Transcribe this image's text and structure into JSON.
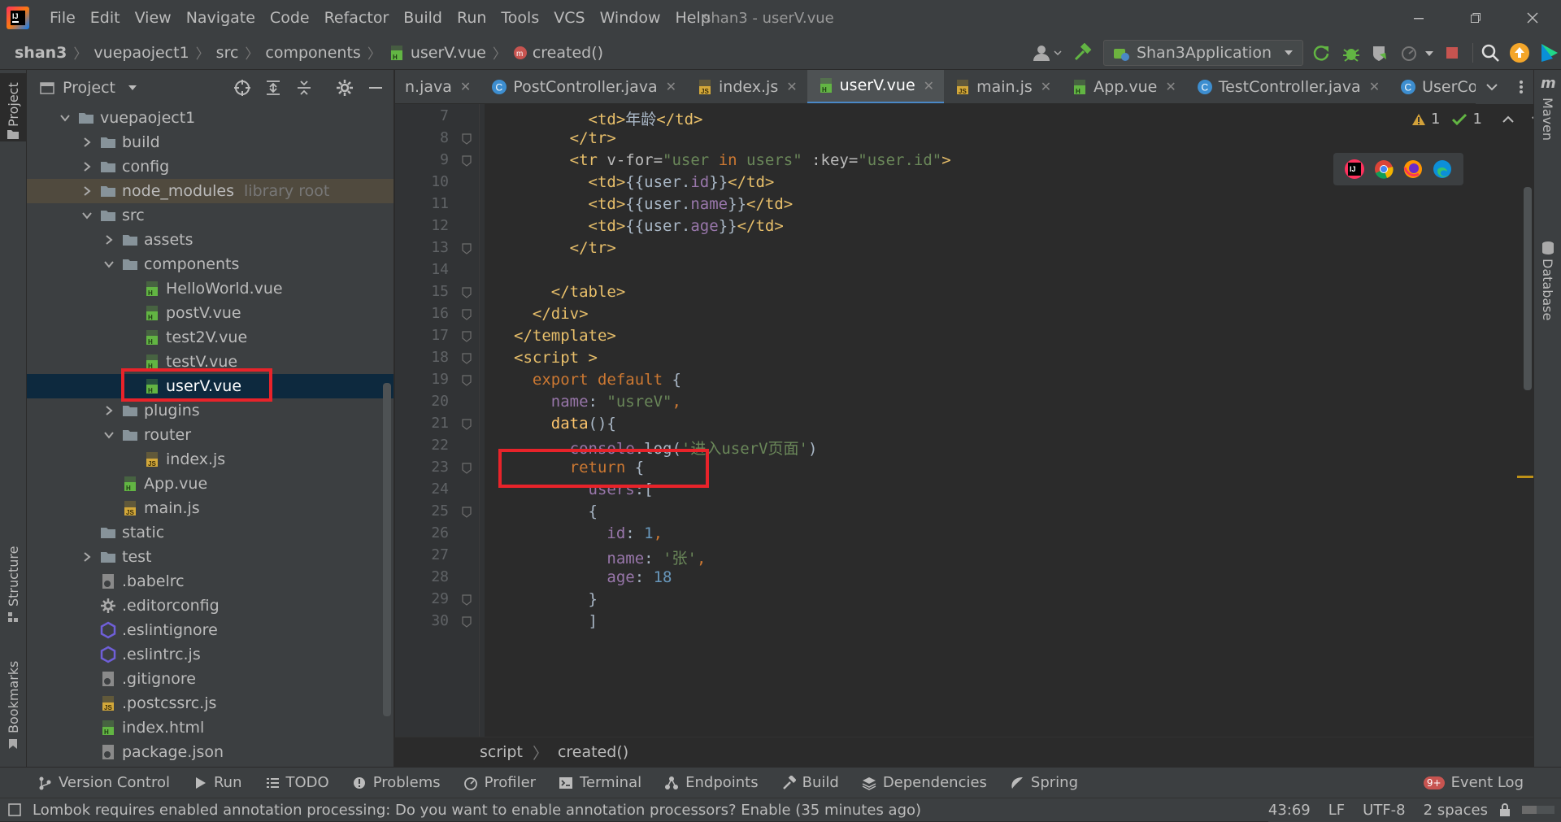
{
  "titlebar": {
    "menu": [
      "File",
      "Edit",
      "View",
      "Navigate",
      "Code",
      "Refactor",
      "Build",
      "Run",
      "Tools",
      "VCS",
      "Window",
      "Help"
    ],
    "title": "shan3 - userV.vue"
  },
  "navbar": {
    "crumbs": [
      "shan3",
      "vuepaoject1",
      "src",
      "components",
      "userV.vue",
      "created()"
    ],
    "run_config": "Shan3Application"
  },
  "project": {
    "header": "Project",
    "tree": [
      {
        "label": "vuepaoject1",
        "depth": 0,
        "icon": "folder-icon",
        "expand": "open"
      },
      {
        "label": "build",
        "depth": 1,
        "icon": "folder-icon",
        "expand": "closed"
      },
      {
        "label": "config",
        "depth": 1,
        "icon": "folder-icon",
        "expand": "closed"
      },
      {
        "label": "node_modules",
        "hint": "library root",
        "depth": 1,
        "icon": "folder-icon",
        "expand": "closed"
      },
      {
        "label": "src",
        "depth": 1,
        "icon": "folder-icon",
        "expand": "open"
      },
      {
        "label": "assets",
        "depth": 2,
        "icon": "folder-icon",
        "expand": "closed"
      },
      {
        "label": "components",
        "depth": 2,
        "icon": "folder-icon",
        "expand": "open"
      },
      {
        "label": "HelloWorld.vue",
        "depth": 3,
        "icon": "vue-file-icon"
      },
      {
        "label": "postV.vue",
        "depth": 3,
        "icon": "vue-file-icon"
      },
      {
        "label": "test2V.vue",
        "depth": 3,
        "icon": "vue-file-icon"
      },
      {
        "label": "testV.vue",
        "depth": 3,
        "icon": "vue-file-icon"
      },
      {
        "label": "userV.vue",
        "depth": 3,
        "icon": "vue-file-icon",
        "selected": true
      },
      {
        "label": "plugins",
        "depth": 2,
        "icon": "folder-icon",
        "expand": "closed"
      },
      {
        "label": "router",
        "depth": 2,
        "icon": "folder-icon",
        "expand": "open"
      },
      {
        "label": "index.js",
        "depth": 3,
        "icon": "js-file-icon"
      },
      {
        "label": "App.vue",
        "depth": 2,
        "icon": "vue-file-icon"
      },
      {
        "label": "main.js",
        "depth": 2,
        "icon": "js-file-icon"
      },
      {
        "label": "static",
        "depth": 1,
        "icon": "folder-icon"
      },
      {
        "label": "test",
        "depth": 1,
        "icon": "folder-icon",
        "expand": "closed"
      },
      {
        "label": ".babelrc",
        "depth": 1,
        "icon": "config-file-icon"
      },
      {
        "label": ".editorconfig",
        "depth": 1,
        "icon": "gear-file-icon"
      },
      {
        "label": ".eslintignore",
        "depth": 1,
        "icon": "eslint-icon"
      },
      {
        "label": ".eslintrc.js",
        "depth": 1,
        "icon": "eslint-icon"
      },
      {
        "label": ".gitignore",
        "depth": 1,
        "icon": "config-file-icon"
      },
      {
        "label": ".postcssrc.js",
        "depth": 1,
        "icon": "js-file-icon"
      },
      {
        "label": "index.html",
        "depth": 1,
        "icon": "html-file-icon"
      },
      {
        "label": "package.json",
        "depth": 1,
        "icon": "config-file-icon"
      }
    ]
  },
  "tabs": [
    {
      "label": "n.java",
      "icon": "none"
    },
    {
      "label": "PostController.java",
      "icon": "class-icon"
    },
    {
      "label": "index.js",
      "icon": "js-file-icon"
    },
    {
      "label": "userV.vue",
      "icon": "vue-file-icon",
      "active": true
    },
    {
      "label": "main.js",
      "icon": "js-file-icon"
    },
    {
      "label": "App.vue",
      "icon": "vue-file-icon"
    },
    {
      "label": "TestController.java",
      "icon": "class-icon"
    },
    {
      "label": "UserController.ja",
      "icon": "class-icon"
    }
  ],
  "inspections": {
    "warnings": "1",
    "ok": "1"
  },
  "code": {
    "line_numbers": [
      "7",
      "8",
      "9",
      "10",
      "11",
      "12",
      "13",
      "14",
      "15",
      "16",
      "17",
      "18",
      "19",
      "20",
      "21",
      "22",
      "23",
      "24",
      "25",
      "26",
      "27",
      "28",
      "29",
      "30"
    ],
    "lines": [
      [
        {
          "t": "        ",
          "c": ""
        },
        {
          "t": "<td>",
          "c": "tag"
        },
        {
          "t": "年龄",
          "c": ""
        },
        {
          "t": "</td>",
          "c": "tag"
        }
      ],
      [
        {
          "t": "      ",
          "c": ""
        },
        {
          "t": "</tr>",
          "c": "tag"
        }
      ],
      [
        {
          "t": "      ",
          "c": ""
        },
        {
          "t": "<tr ",
          "c": "tag"
        },
        {
          "t": "v-for=",
          "c": "attr"
        },
        {
          "t": "\"user ",
          "c": "str"
        },
        {
          "t": "in",
          "c": "kw"
        },
        {
          "t": " users\"",
          "c": "str"
        },
        {
          "t": " :key=",
          "c": "attr"
        },
        {
          "t": "\"user.id\"",
          "c": "str"
        },
        {
          "t": ">",
          "c": "tag"
        }
      ],
      [
        {
          "t": "        ",
          "c": ""
        },
        {
          "t": "<td>",
          "c": "tag"
        },
        {
          "t": "{{user.",
          "c": ""
        },
        {
          "t": "id",
          "c": "prop"
        },
        {
          "t": "}}",
          "c": ""
        },
        {
          "t": "</td>",
          "c": "tag"
        }
      ],
      [
        {
          "t": "        ",
          "c": ""
        },
        {
          "t": "<td>",
          "c": "tag"
        },
        {
          "t": "{{user.",
          "c": ""
        },
        {
          "t": "name",
          "c": "prop"
        },
        {
          "t": "}}",
          "c": ""
        },
        {
          "t": "</td>",
          "c": "tag"
        }
      ],
      [
        {
          "t": "        ",
          "c": ""
        },
        {
          "t": "<td>",
          "c": "tag"
        },
        {
          "t": "{{user.",
          "c": ""
        },
        {
          "t": "age",
          "c": "prop"
        },
        {
          "t": "}}",
          "c": ""
        },
        {
          "t": "</td>",
          "c": "tag"
        }
      ],
      [
        {
          "t": "      ",
          "c": ""
        },
        {
          "t": "</tr>",
          "c": "tag"
        }
      ],
      [],
      [
        {
          "t": "    ",
          "c": ""
        },
        {
          "t": "</table>",
          "c": "tag"
        }
      ],
      [
        {
          "t": "  ",
          "c": ""
        },
        {
          "t": "</div>",
          "c": "tag"
        }
      ],
      [
        {
          "t": "</template>",
          "c": "tag"
        }
      ],
      [
        {
          "t": "<script >",
          "c": "tag"
        }
      ],
      [
        {
          "t": "  ",
          "c": ""
        },
        {
          "t": "export default",
          "c": "kw"
        },
        {
          "t": " {",
          "c": ""
        }
      ],
      [
        {
          "t": "    ",
          "c": ""
        },
        {
          "t": "name",
          "c": "prop"
        },
        {
          "t": ": ",
          "c": ""
        },
        {
          "t": "\"usreV\"",
          "c": "str"
        },
        {
          "t": ",",
          "c": "kw"
        }
      ],
      [
        {
          "t": "    ",
          "c": ""
        },
        {
          "t": "data",
          "c": "fn"
        },
        {
          "t": "(){",
          "c": ""
        }
      ],
      [
        {
          "t": "      ",
          "c": ""
        },
        {
          "t": "console",
          "c": "prop"
        },
        {
          "t": ".log(",
          "c": ""
        },
        {
          "t": "'进入userV页面'",
          "c": "str"
        },
        {
          "t": ")",
          "c": ""
        }
      ],
      [
        {
          "t": "      ",
          "c": ""
        },
        {
          "t": "return",
          "c": "kw"
        },
        {
          "t": " {",
          "c": ""
        }
      ],
      [
        {
          "t": "        ",
          "c": ""
        },
        {
          "t": "users",
          "c": "prop"
        },
        {
          "t": ":[",
          "c": ""
        }
      ],
      [
        {
          "t": "        {",
          "c": ""
        }
      ],
      [
        {
          "t": "          ",
          "c": ""
        },
        {
          "t": "id",
          "c": "prop"
        },
        {
          "t": ": ",
          "c": ""
        },
        {
          "t": "1",
          "c": "num"
        },
        {
          "t": ",",
          "c": "kw"
        }
      ],
      [
        {
          "t": "          ",
          "c": ""
        },
        {
          "t": "name",
          "c": "prop"
        },
        {
          "t": ": ",
          "c": ""
        },
        {
          "t": "'张'",
          "c": "str"
        },
        {
          "t": ",",
          "c": "kw"
        }
      ],
      [
        {
          "t": "          ",
          "c": ""
        },
        {
          "t": "age",
          "c": "prop"
        },
        {
          "t": ": ",
          "c": ""
        },
        {
          "t": "18",
          "c": "num"
        }
      ],
      [
        {
          "t": "        }",
          "c": ""
        }
      ],
      [
        {
          "t": "        ]",
          "c": ""
        }
      ]
    ]
  },
  "editor_breadcrumb": [
    "script",
    "created()"
  ],
  "right_stripe": [
    "Maven",
    "Database"
  ],
  "left_stripe": [
    "Project",
    "Structure",
    "Bookmarks"
  ],
  "toolwindows": [
    "Version Control",
    "Run",
    "TODO",
    "Problems",
    "Profiler",
    "Terminal",
    "Endpoints",
    "Build",
    "Dependencies",
    "Spring"
  ],
  "event_log": {
    "label": "Event Log",
    "badge": "9+"
  },
  "status": {
    "message": "Lombok requires enabled annotation processing: Do you want to enable annotation processors? Enable (35 minutes ago)",
    "position": "43:69",
    "line_sep": "LF",
    "encoding": "UTF-8",
    "indent": "2 spaces"
  },
  "colors": {
    "accent": "#4a88c7",
    "highlight_box": "#e8232a",
    "selection": "#0d293e"
  }
}
